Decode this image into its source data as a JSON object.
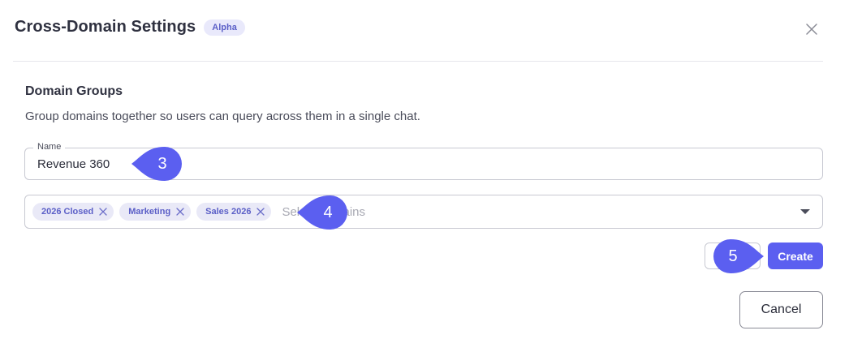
{
  "dialog": {
    "title": "Cross-Domain Settings",
    "badge": "Alpha",
    "close_icon": "close-icon"
  },
  "section": {
    "title": "Domain Groups",
    "description": "Group domains together so users can query across them in a single chat."
  },
  "name_field": {
    "label": "Name",
    "value": "Revenue 360"
  },
  "domains_field": {
    "chips": [
      "2026 Closed",
      "Marketing",
      "Sales 2026"
    ],
    "placeholder": "Select domains",
    "dropdown_icon": "chevron-down-icon"
  },
  "actions": {
    "cancel_label": "",
    "create_label": "Create"
  },
  "footer": {
    "cancel_label": "Cancel"
  },
  "step_markers": [
    "3",
    "4",
    "5"
  ],
  "colors": {
    "accent": "#5b5ff0",
    "marker": "#5b5ff0",
    "chip_bg": "#e9e9f7",
    "chip_text": "#5b5fc7"
  }
}
